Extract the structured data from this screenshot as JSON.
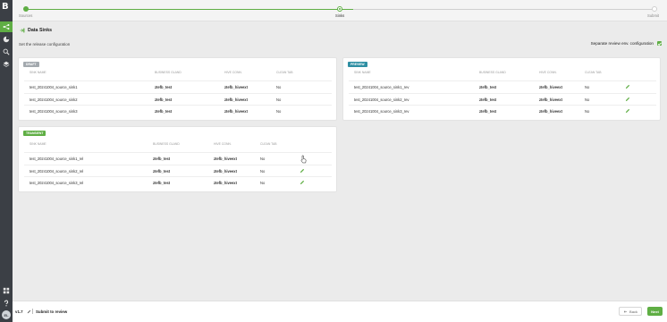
{
  "app": {
    "logo_letter": "B"
  },
  "rail": {
    "items": [
      {
        "icon": "sink-flow-icon",
        "active": true
      },
      {
        "icon": "pie-chart-icon",
        "active": false
      },
      {
        "icon": "search-icon",
        "active": false
      },
      {
        "icon": "layers-icon",
        "active": false
      },
      {
        "icon": "apps-grid-icon",
        "active": false
      },
      {
        "icon": "help-icon",
        "active": false
      }
    ],
    "avatar": "EL"
  },
  "stepper": {
    "steps": [
      {
        "label": "Sources",
        "state": "done"
      },
      {
        "label": "Sinks",
        "state": "current"
      },
      {
        "label": "Submit",
        "state": "todo"
      }
    ]
  },
  "header": {
    "title": "Data Sinks",
    "subtitle": "Set the release configuration",
    "separate_label": "Separate review env. configuration",
    "separate_checked": true
  },
  "columns": {
    "sink_name": "SINK NAME",
    "business_gland": "BUSINESS GLAND",
    "hive_conn": "HIVE CONN.",
    "clean_tab": "CLEAN TAB"
  },
  "draft": {
    "badge": "DRAFT",
    "rows": [
      {
        "name": "test_20241004_source_sink1",
        "gland": "ztefb_test",
        "hive": "ztefb_hiveext",
        "clean": "No"
      },
      {
        "name": "test_20241004_source_sink2",
        "gland": "ztefb_test",
        "hive": "ztefb_hiveext",
        "clean": "No"
      },
      {
        "name": "test_20241004_source_sink3",
        "gland": "ztefb_test",
        "hive": "ztefb_hiveext",
        "clean": "No"
      }
    ]
  },
  "preview": {
    "badge": "PREVIEW",
    "rows": [
      {
        "name": "test_20241004_source_sink1_rev",
        "gland": "ztefb_test",
        "hive": "ztefb_hiveext",
        "clean": "No"
      },
      {
        "name": "test_20241004_source_sink2_rev",
        "gland": "ztefb_test",
        "hive": "ztefb_hiveext",
        "clean": "No"
      },
      {
        "name": "test_20241004_source_sink3_rev",
        "gland": "ztefb_test",
        "hive": "ztefb_hiveext",
        "clean": "No"
      }
    ]
  },
  "transient": {
    "badge": "TRANSIENT",
    "rows": [
      {
        "name": "test_20241004_source_sink1_rel",
        "gland": "ztefb_test",
        "hive": "ztefb_hiveext",
        "clean": "No"
      },
      {
        "name": "test_20241004_source_sink2_rel",
        "gland": "ztefb_test",
        "hive": "ztefb_hiveext",
        "clean": "No"
      },
      {
        "name": "test_20241004_source_sink3_rel",
        "gland": "ztefb_test",
        "hive": "ztefb_hiveext",
        "clean": "No"
      }
    ]
  },
  "footer": {
    "version": "v1.7",
    "submit_label": "Submit to review",
    "back_label": "Back",
    "next_label": "Next"
  },
  "colors": {
    "accent": "#5fae44",
    "preview": "#2f8fa3",
    "draft": "#a3a9ae",
    "rail": "#3b3f45"
  }
}
